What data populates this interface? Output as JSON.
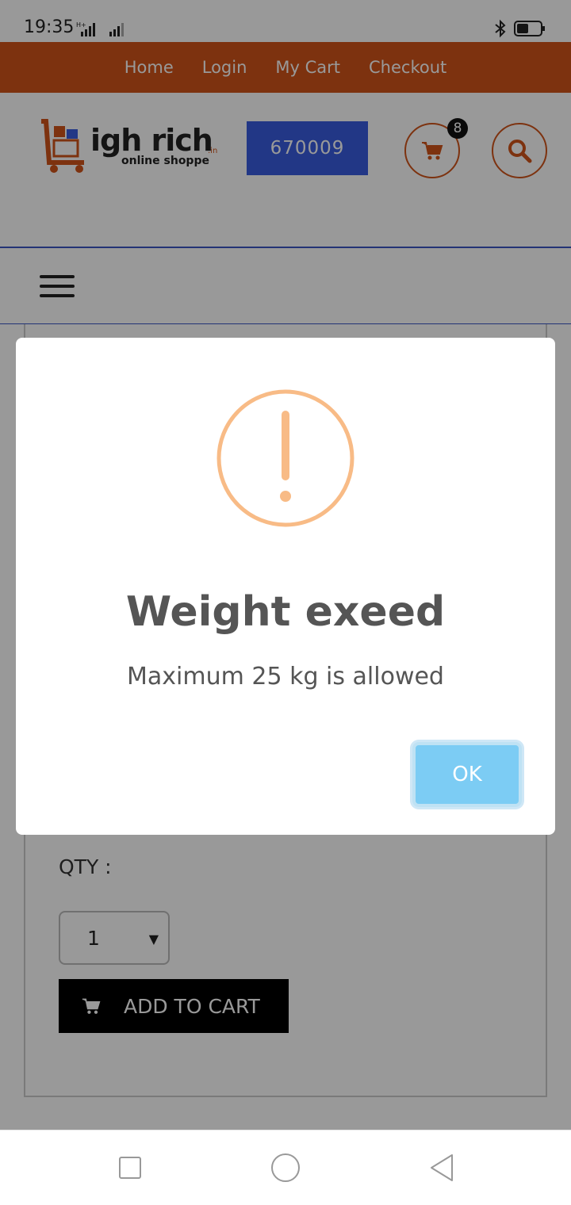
{
  "status": {
    "time": "19:35",
    "network": "H+"
  },
  "nav": {
    "items": [
      "Home",
      "Login",
      "My Cart",
      "Checkout"
    ]
  },
  "header": {
    "logo_text": "igh rich",
    "logo_sub": "online shoppe",
    "logo_domain": ".in",
    "pincode": "670009",
    "cart_count": "8"
  },
  "product": {
    "qty_label": "QTY :",
    "qty_value": "1",
    "add_to_cart_label": "ADD TO CART"
  },
  "modal": {
    "title": "Weight exeed",
    "message": "Maximum 25 kg is allowed",
    "ok_label": "OK"
  },
  "colors": {
    "brand_orange": "#d0541a",
    "pin_blue": "#3a5de0",
    "warning": "#f8bb86",
    "ok_button": "#7cccf4"
  }
}
